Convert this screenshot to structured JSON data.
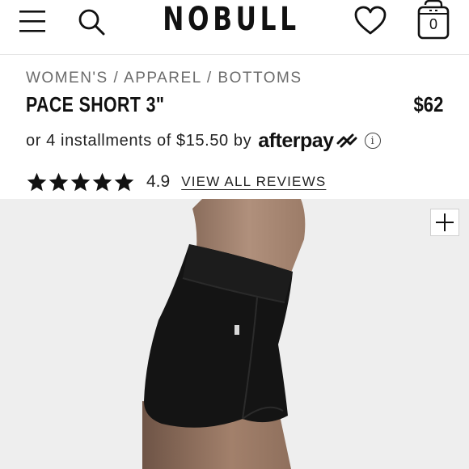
{
  "header": {
    "logo": "NOBULL",
    "cart_count": "0"
  },
  "product": {
    "breadcrumb": "WOMEN'S / APPAREL / BOTTOMS",
    "title": "PACE SHORT 3\"",
    "price": "$62",
    "installments_text": "or 4 installments of $15.50 by",
    "afterpay_brand": "afterpay",
    "rating_value": "4.9",
    "rating_stars": 5,
    "reviews_link": "VIEW ALL REVIEWS"
  },
  "icons": {
    "menu": "hamburger-menu-icon",
    "search": "search-icon",
    "wishlist": "heart-icon",
    "cart": "shopping-bag-icon",
    "info": "info-icon",
    "zoom": "plus-icon"
  },
  "colors": {
    "text": "#111111",
    "muted": "#6b6b6b",
    "photo_bg": "#eeeeee"
  }
}
